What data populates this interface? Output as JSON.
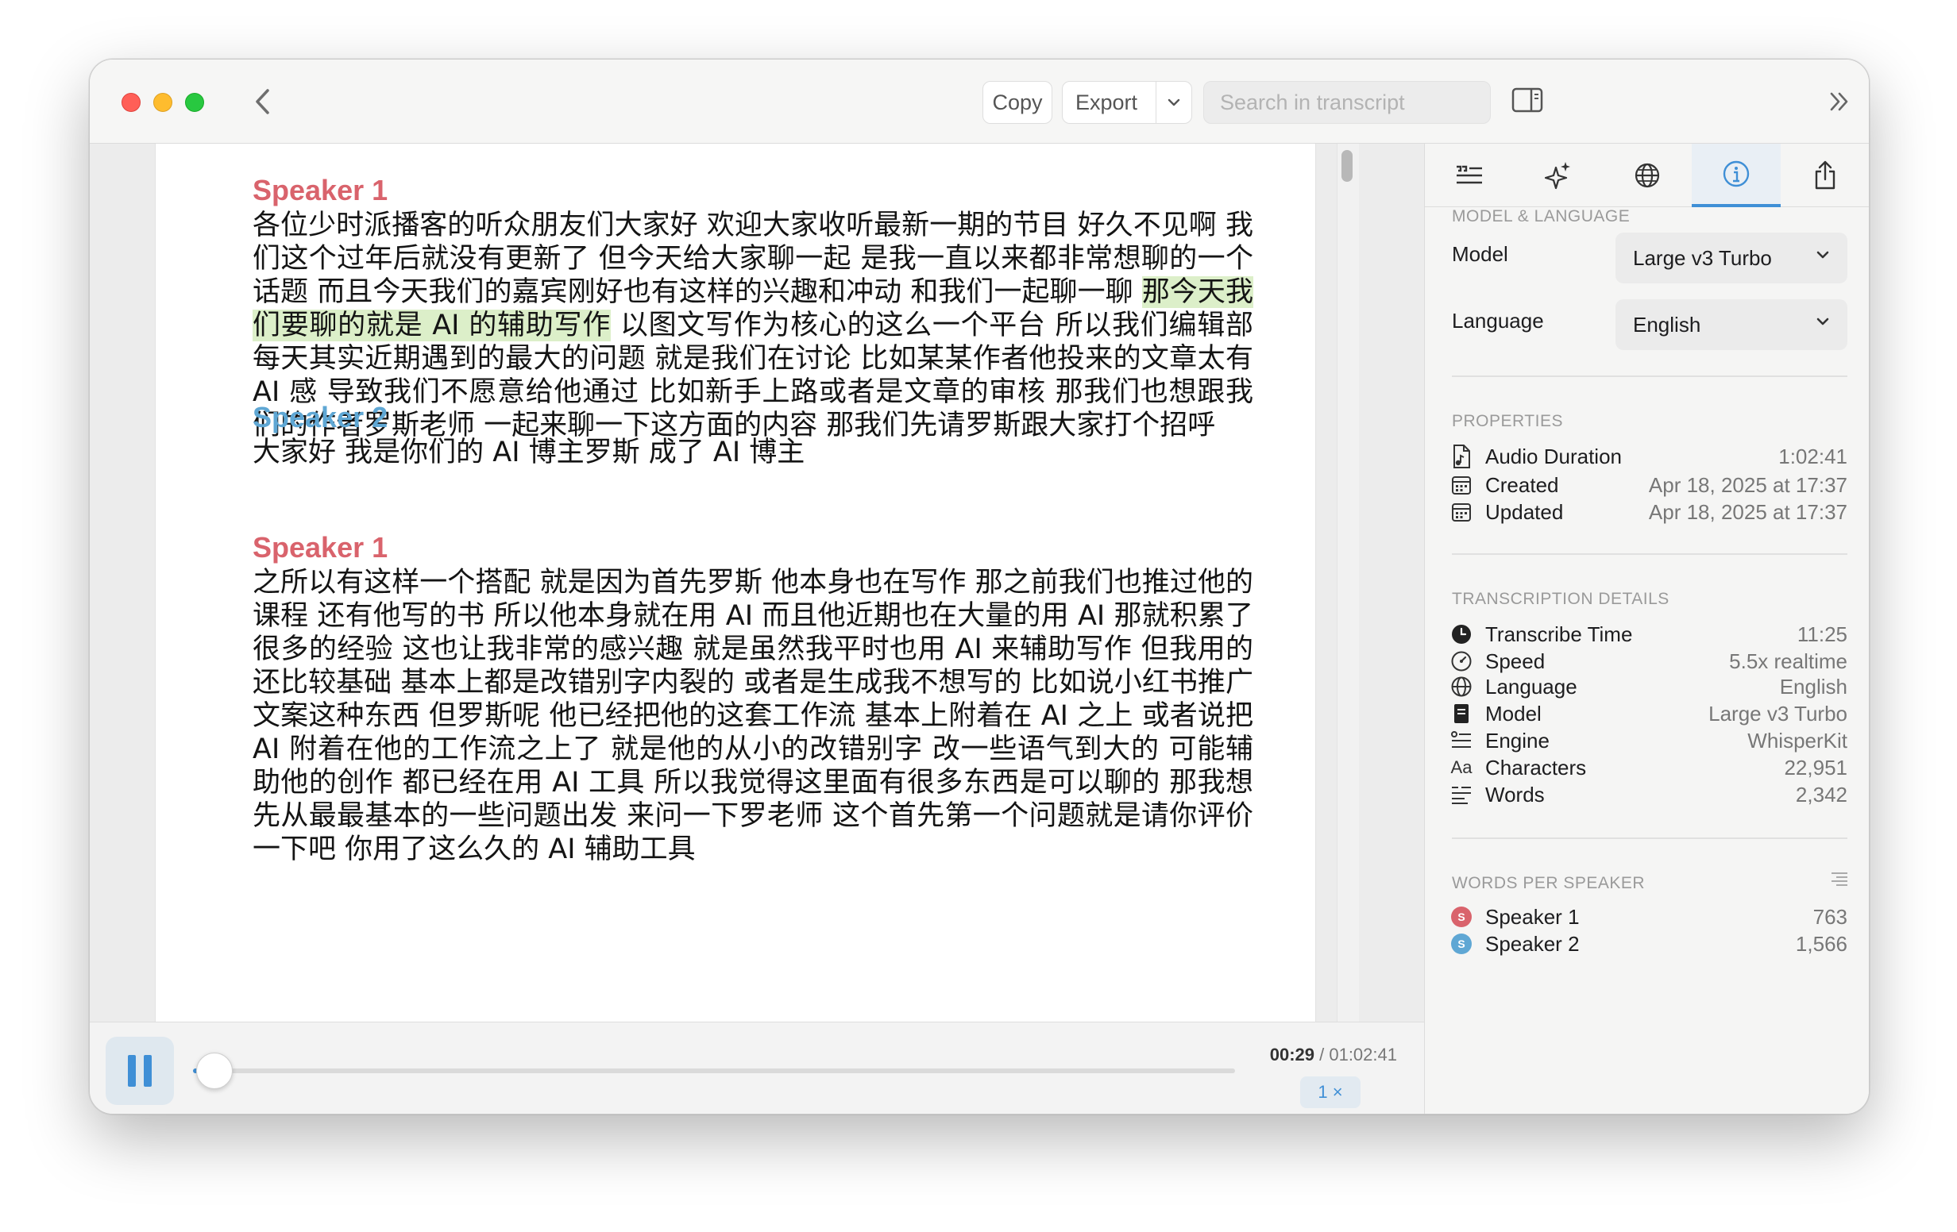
{
  "toolbar": {
    "copy_label": "Copy",
    "export_label": "Export",
    "search_placeholder": "Search in transcript"
  },
  "transcript": {
    "segments": [
      {
        "speaker": "Speaker 1",
        "text_before": "各位少时派播客的听众朋友们大家好  欢迎大家收听最新一期的节目  好久不见啊  我们这个过年后就没有更新了  但今天给大家聊一起  是我一直以来都非常想聊的一个话题  而且今天我们的嘉宾刚好也有这样的兴趣和冲动  和我们一起聊一聊  ",
        "text_highlight": "那今天我们要聊的就是 AI 的辅助写作",
        "text_after": "  以图文写作为核心的这么一个平台  所以我们编辑部每天其实近期遇到的最大的问题  就是我们在讨论  比如某某作者他投来的文章太有 AI 感  导致我们不愿意给他通过  比如新手上路或者是文章的审核  那我们也想跟我们的作者罗斯老师  一起来聊一下这方面的内容  那我们先请罗斯跟大家打个招呼"
      },
      {
        "speaker": "Speaker 2",
        "text": "大家好  我是你们的 AI 博主罗斯  成了 AI 博主"
      },
      {
        "speaker": "Speaker 1",
        "text": "之所以有这样一个搭配  就是因为首先罗斯  他本身也在写作  那之前我们也推过他的课程  还有他写的书  所以他本身就在用 AI  而且他近期也在大量的用 AI  那就积累了很多的经验  这也让我非常的感兴趣  就是虽然我平时也用 AI 来辅助写作  但我用的还比较基础  基本上都是改错别字内裂的  或者是生成我不想写的  比如说小红书推广文案这种东西  但罗斯呢  他已经把他的这套工作流  基本上附着在 AI 之上  或者说把 AI 附着在他的工作流之上了  就是他的从小的改错别字  改一些语气到大的  可能辅助他的创作  都已经在用 AI 工具  所以我觉得这里面有很多东西是可以聊的  那我想先从最最基本的一些问题出发  来问一下罗老师  这个首先第一个问题就是请你评价一下吧  你用了这么久的 AI 辅助工具"
      }
    ]
  },
  "player": {
    "current_time": "00:29",
    "total_time": "/ 01:02:41",
    "progress": 0.0077,
    "speed_label": "1 ×"
  },
  "inspector": {
    "model_language": {
      "title": "MODEL & LANGUAGE",
      "model_label": "Model",
      "model_value": "Large v3 Turbo",
      "language_label": "Language",
      "language_value": "English"
    },
    "properties": {
      "title": "PROPERTIES",
      "audio_duration_label": "Audio Duration",
      "audio_duration_value": "1:02:41",
      "created_label": "Created",
      "created_value": "Apr 18, 2025 at 17:37",
      "updated_label": "Updated",
      "updated_value": "Apr 18, 2025 at 17:37"
    },
    "details": {
      "title": "TRANSCRIPTION DETAILS",
      "transcribe_time_label": "Transcribe Time",
      "transcribe_time_value": "11:25",
      "speed_label": "Speed",
      "speed_value": "5.5x realtime",
      "language_label": "Language",
      "language_value": "English",
      "model_label": "Model",
      "model_value": "Large v3 Turbo",
      "engine_label": "Engine",
      "engine_value": "WhisperKit",
      "characters_icon": "Aa",
      "characters_label": "Characters",
      "characters_value": "22,951",
      "words_label": "Words",
      "words_value": "2,342"
    },
    "words_per_speaker": {
      "title": "WORDS PER SPEAKER",
      "speakers": [
        {
          "badge": "S",
          "name": "Speaker 1",
          "words": "763",
          "color": "#d9636c"
        },
        {
          "badge": "S",
          "name": "Speaker 2",
          "words": "1,566",
          "color": "#5fa7d4"
        }
      ]
    }
  },
  "colors": {
    "accent": "#3f8fd6",
    "speaker1": "#d9636c",
    "speaker2": "#5fa7d4",
    "highlight": "#dcefc9"
  },
  "icons": [
    "back-chevron-icon",
    "chevron-down-icon",
    "sidebar-icon",
    "double-chevron-right-icon",
    "quote-list-icon",
    "sparkles-icon",
    "globe-icon",
    "info-icon",
    "share-icon",
    "audio-file-icon",
    "calendar-icon",
    "clock-icon",
    "gauge-icon",
    "document-icon",
    "engine-icon",
    "text-lines-icon"
  ]
}
